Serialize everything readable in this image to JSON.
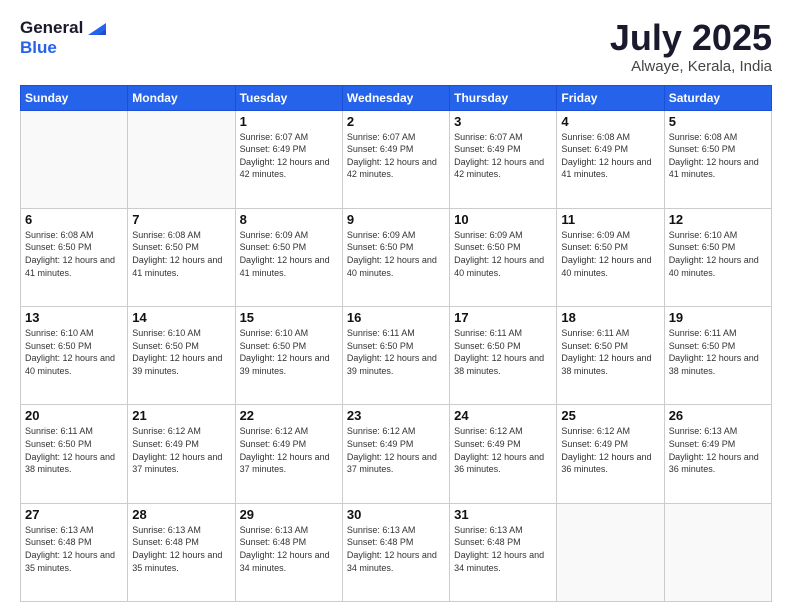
{
  "logo": {
    "line1": "General",
    "line2": "Blue"
  },
  "title": "July 2025",
  "subtitle": "Alwaye, Kerala, India",
  "weekdays": [
    "Sunday",
    "Monday",
    "Tuesday",
    "Wednesday",
    "Thursday",
    "Friday",
    "Saturday"
  ],
  "weeks": [
    [
      {
        "day": "",
        "info": ""
      },
      {
        "day": "",
        "info": ""
      },
      {
        "day": "1",
        "info": "Sunrise: 6:07 AM\nSunset: 6:49 PM\nDaylight: 12 hours and 42 minutes."
      },
      {
        "day": "2",
        "info": "Sunrise: 6:07 AM\nSunset: 6:49 PM\nDaylight: 12 hours and 42 minutes."
      },
      {
        "day": "3",
        "info": "Sunrise: 6:07 AM\nSunset: 6:49 PM\nDaylight: 12 hours and 42 minutes."
      },
      {
        "day": "4",
        "info": "Sunrise: 6:08 AM\nSunset: 6:49 PM\nDaylight: 12 hours and 41 minutes."
      },
      {
        "day": "5",
        "info": "Sunrise: 6:08 AM\nSunset: 6:50 PM\nDaylight: 12 hours and 41 minutes."
      }
    ],
    [
      {
        "day": "6",
        "info": "Sunrise: 6:08 AM\nSunset: 6:50 PM\nDaylight: 12 hours and 41 minutes."
      },
      {
        "day": "7",
        "info": "Sunrise: 6:08 AM\nSunset: 6:50 PM\nDaylight: 12 hours and 41 minutes."
      },
      {
        "day": "8",
        "info": "Sunrise: 6:09 AM\nSunset: 6:50 PM\nDaylight: 12 hours and 41 minutes."
      },
      {
        "day": "9",
        "info": "Sunrise: 6:09 AM\nSunset: 6:50 PM\nDaylight: 12 hours and 40 minutes."
      },
      {
        "day": "10",
        "info": "Sunrise: 6:09 AM\nSunset: 6:50 PM\nDaylight: 12 hours and 40 minutes."
      },
      {
        "day": "11",
        "info": "Sunrise: 6:09 AM\nSunset: 6:50 PM\nDaylight: 12 hours and 40 minutes."
      },
      {
        "day": "12",
        "info": "Sunrise: 6:10 AM\nSunset: 6:50 PM\nDaylight: 12 hours and 40 minutes."
      }
    ],
    [
      {
        "day": "13",
        "info": "Sunrise: 6:10 AM\nSunset: 6:50 PM\nDaylight: 12 hours and 40 minutes."
      },
      {
        "day": "14",
        "info": "Sunrise: 6:10 AM\nSunset: 6:50 PM\nDaylight: 12 hours and 39 minutes."
      },
      {
        "day": "15",
        "info": "Sunrise: 6:10 AM\nSunset: 6:50 PM\nDaylight: 12 hours and 39 minutes."
      },
      {
        "day": "16",
        "info": "Sunrise: 6:11 AM\nSunset: 6:50 PM\nDaylight: 12 hours and 39 minutes."
      },
      {
        "day": "17",
        "info": "Sunrise: 6:11 AM\nSunset: 6:50 PM\nDaylight: 12 hours and 38 minutes."
      },
      {
        "day": "18",
        "info": "Sunrise: 6:11 AM\nSunset: 6:50 PM\nDaylight: 12 hours and 38 minutes."
      },
      {
        "day": "19",
        "info": "Sunrise: 6:11 AM\nSunset: 6:50 PM\nDaylight: 12 hours and 38 minutes."
      }
    ],
    [
      {
        "day": "20",
        "info": "Sunrise: 6:11 AM\nSunset: 6:50 PM\nDaylight: 12 hours and 38 minutes."
      },
      {
        "day": "21",
        "info": "Sunrise: 6:12 AM\nSunset: 6:49 PM\nDaylight: 12 hours and 37 minutes."
      },
      {
        "day": "22",
        "info": "Sunrise: 6:12 AM\nSunset: 6:49 PM\nDaylight: 12 hours and 37 minutes."
      },
      {
        "day": "23",
        "info": "Sunrise: 6:12 AM\nSunset: 6:49 PM\nDaylight: 12 hours and 37 minutes."
      },
      {
        "day": "24",
        "info": "Sunrise: 6:12 AM\nSunset: 6:49 PM\nDaylight: 12 hours and 36 minutes."
      },
      {
        "day": "25",
        "info": "Sunrise: 6:12 AM\nSunset: 6:49 PM\nDaylight: 12 hours and 36 minutes."
      },
      {
        "day": "26",
        "info": "Sunrise: 6:13 AM\nSunset: 6:49 PM\nDaylight: 12 hours and 36 minutes."
      }
    ],
    [
      {
        "day": "27",
        "info": "Sunrise: 6:13 AM\nSunset: 6:48 PM\nDaylight: 12 hours and 35 minutes."
      },
      {
        "day": "28",
        "info": "Sunrise: 6:13 AM\nSunset: 6:48 PM\nDaylight: 12 hours and 35 minutes."
      },
      {
        "day": "29",
        "info": "Sunrise: 6:13 AM\nSunset: 6:48 PM\nDaylight: 12 hours and 34 minutes."
      },
      {
        "day": "30",
        "info": "Sunrise: 6:13 AM\nSunset: 6:48 PM\nDaylight: 12 hours and 34 minutes."
      },
      {
        "day": "31",
        "info": "Sunrise: 6:13 AM\nSunset: 6:48 PM\nDaylight: 12 hours and 34 minutes."
      },
      {
        "day": "",
        "info": ""
      },
      {
        "day": "",
        "info": ""
      }
    ]
  ]
}
